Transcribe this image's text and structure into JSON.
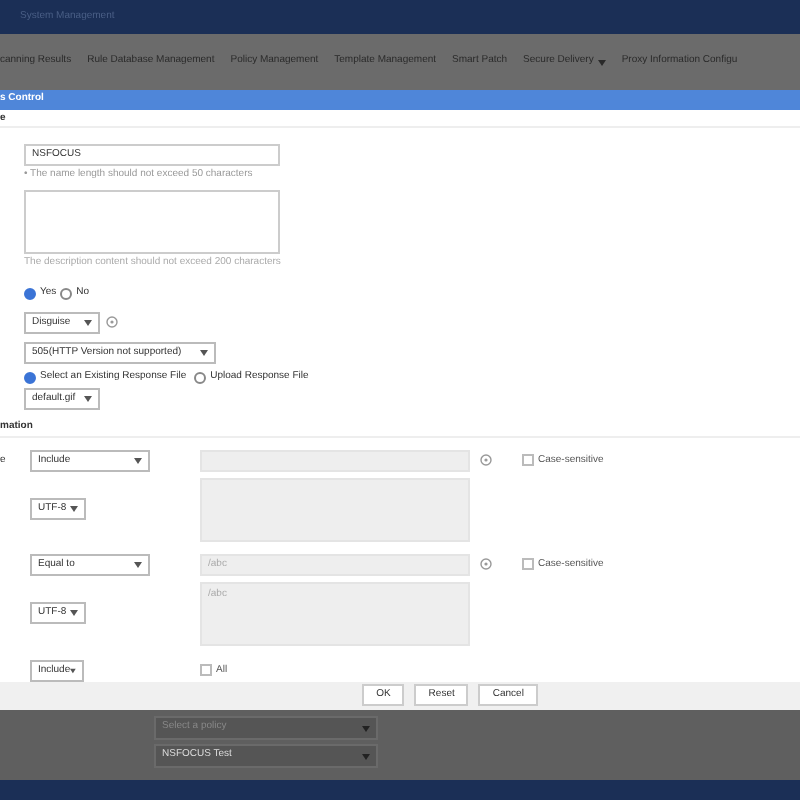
{
  "app_title": "System Management",
  "nav_tabs": [
    {
      "label": "canning Results",
      "dropdown": false
    },
    {
      "label": "Rule Database Management",
      "dropdown": false
    },
    {
      "label": "Policy Management",
      "dropdown": false
    },
    {
      "label": "Template Management",
      "dropdown": false
    },
    {
      "label": "Smart Patch",
      "dropdown": false
    },
    {
      "label": "Secure Delivery",
      "dropdown": true
    },
    {
      "label": "Proxy Information Configu",
      "dropdown": false
    }
  ],
  "dialog": {
    "title": "s Control",
    "section_1_label": "e",
    "name_value": "NSFOCUS",
    "name_hint": "• The name length should not exceed 50 characters",
    "description_hint": "The description content should not exceed 200 characters",
    "enable_options": [
      {
        "label": "Yes",
        "selected": true
      },
      {
        "label": "No",
        "selected": false
      }
    ],
    "action_select": "Disguise",
    "status_select": "505(HTTP Version not supported)",
    "file_options": [
      {
        "label": "Select an Existing Response File",
        "selected": true
      },
      {
        "label": "Upload Response File",
        "selected": false
      }
    ],
    "file_select": "default.gif",
    "section_2_title": "mation",
    "rules": [
      {
        "label": "e",
        "operator": "Include",
        "encoding": "UTF-8",
        "case_sensitive": false,
        "case_label": "Case-sensitive"
      },
      {
        "operator": "Equal to",
        "encoding": "UTF-8",
        "value": "/abc",
        "content": "/abc",
        "case_sensitive": false,
        "case_label": "Case-sensitive"
      }
    ],
    "method_operator": "Include",
    "method_all": {
      "label": "All",
      "checked": false
    },
    "buttons": [
      "OK",
      "Reset",
      "Cancel"
    ]
  },
  "background_selects": [
    "Select a policy",
    "NSFOCUS Test"
  ]
}
